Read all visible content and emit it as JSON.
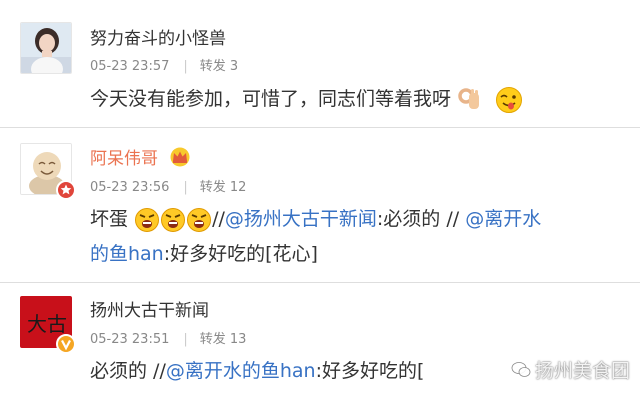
{
  "posts": [
    {
      "username": "努力奋斗的小怪兽",
      "date": "05-23 23:57",
      "repost": "转发 3",
      "text": "今天没有能参加，可惜了，同志们等着我呀"
    },
    {
      "username": "阿呆伟哥",
      "date": "05-23 23:56",
      "repost": "转发 12",
      "text_a": "坏蛋",
      "sep1": "//",
      "mention1": "@扬州大古干新闻",
      "text_b": ":必须的 //",
      "mention2_part1": "@离开水",
      "mention2_part2": "的鱼han",
      "text_c": ":好多好吃的[花心]"
    },
    {
      "username": "扬州大古干新闻",
      "date": "05-23 23:51",
      "repost": "转发 13",
      "text_a": "必须的 //",
      "mention": "@离开水的鱼han",
      "text_b": ":好多好吃的[",
      "avatar_text": "大古"
    }
  ],
  "watermark": "扬州美食团",
  "colors": {
    "mention": "#3872c4",
    "vip_name": "#eb7350",
    "meta": "#888888",
    "separator": "#dedede"
  }
}
